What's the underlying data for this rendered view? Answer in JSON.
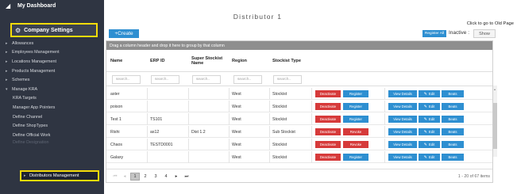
{
  "sidebar": {
    "dashboard": "My Dashboard",
    "company_settings": "Company Settings",
    "items": [
      {
        "label": "Allowances",
        "arrow": "▸",
        "sub": false
      },
      {
        "label": "Employees Management",
        "arrow": "▸",
        "sub": false
      },
      {
        "label": "Locations Management",
        "arrow": "▸",
        "sub": false
      },
      {
        "label": "Products Management",
        "arrow": "▸",
        "sub": false
      },
      {
        "label": "Schemes",
        "arrow": "▸",
        "sub": false
      },
      {
        "label": "Manage KRA",
        "arrow": "▾",
        "sub": false
      },
      {
        "label": "KRA Targets",
        "arrow": "",
        "sub": true
      },
      {
        "label": "Manager App Pointers",
        "arrow": "",
        "sub": true
      },
      {
        "label": "Define Channel",
        "arrow": "",
        "sub": true
      },
      {
        "label": "Define ShopTypes",
        "arrow": "",
        "sub": true
      },
      {
        "label": "Define Official Work",
        "arrow": "",
        "sub": true
      }
    ],
    "faded_item": "Define Designation",
    "distributors": "Distributors Management"
  },
  "main": {
    "title": "Distributor 1",
    "old_page_link": "Click to go to Old Page",
    "create_button": "+Create",
    "register_all": "Register All",
    "inactive_label": "Inactive :",
    "show_button": "Show",
    "group_hint": "Drag a column header and drop it here to group by that column",
    "columns": [
      "Name",
      "ERP ID",
      "Super Stockist Name",
      "Region",
      "Stockist Type"
    ],
    "filter_placeholders": [
      "search..",
      "search..",
      "search..",
      "search..",
      "search.."
    ],
    "rows": [
      {
        "name": "aster",
        "erp": "",
        "super": "",
        "region": "West",
        "type": "Stockist",
        "status": "Register"
      },
      {
        "name": "poison",
        "erp": "",
        "super": "",
        "region": "West",
        "type": "Stockist",
        "status": "Register"
      },
      {
        "name": "Test 1",
        "erp": "TS101",
        "super": "",
        "region": "West",
        "type": "Stockist",
        "status": "Register"
      },
      {
        "name": "Rishi",
        "erp": "as12",
        "super": "Dist 1.2",
        "region": "West",
        "type": "Sub Stockist",
        "status": "Revoke"
      },
      {
        "name": "Chaos",
        "erp": "TESTD0001",
        "super": "",
        "region": "West",
        "type": "Stockist",
        "status": "Revoke"
      },
      {
        "name": "Galaxy",
        "erp": "",
        "super": "",
        "region": "West",
        "type": "Stockist",
        "status": "Register"
      }
    ],
    "actions": {
      "deactivate": "Deactivate",
      "view_details": "View Details",
      "edit": "Edit",
      "beats": "Beats"
    },
    "pager": {
      "first": "⏮",
      "prev": "◂",
      "pages": [
        "1",
        "2",
        "3",
        "4"
      ],
      "next": "▸",
      "last": "⏭",
      "info": "1 - 20 of 67 items"
    }
  }
}
